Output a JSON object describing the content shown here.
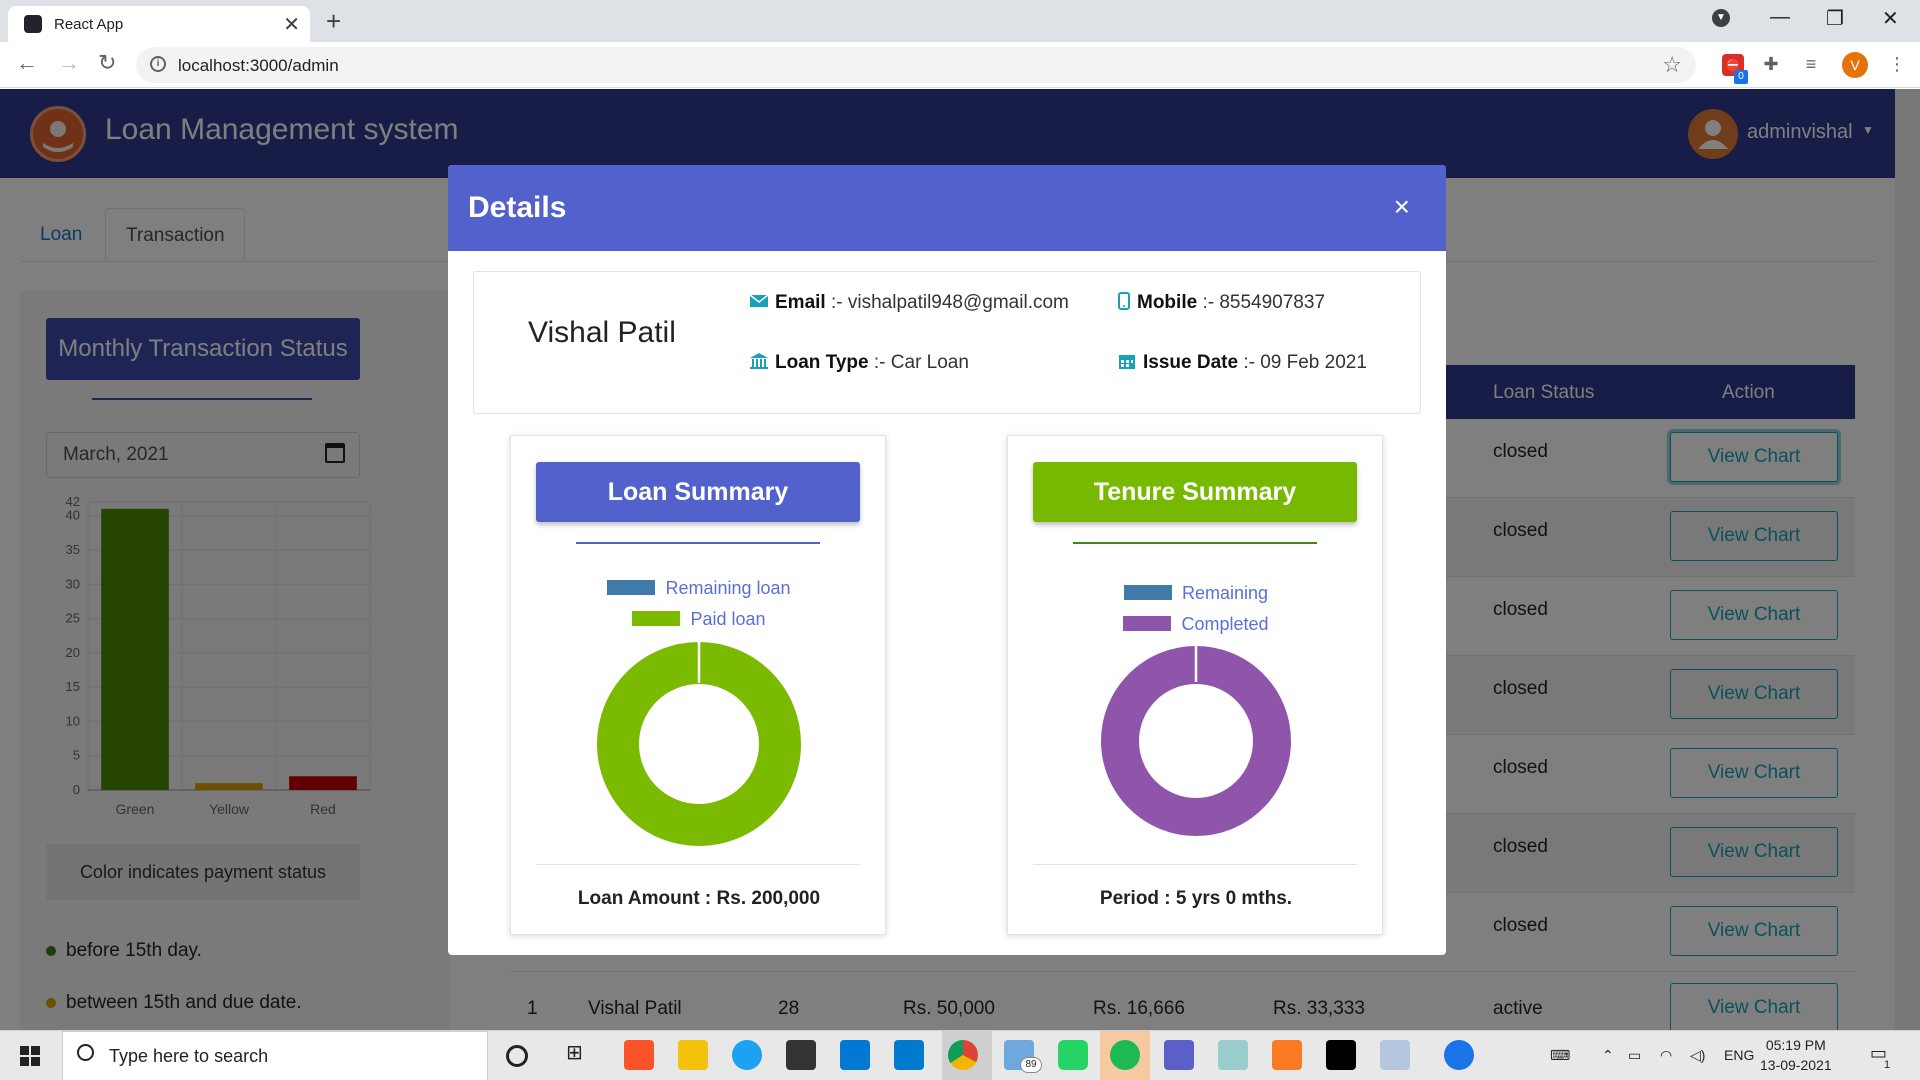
{
  "browser": {
    "tab_title": "React App",
    "url": "localhost:3000/admin",
    "profile_initial": "V",
    "extension_badge": "0"
  },
  "app": {
    "title": "Loan Management system",
    "user": "adminvishal",
    "tabs": [
      "Loan",
      "Transaction"
    ]
  },
  "sidebar": {
    "button_label": "Monthly Transaction Status",
    "month_value": "March, 2021",
    "chart_note": "Color indicates payment status",
    "legend": [
      {
        "label": "before 15th day.",
        "color": "#3a7d0a"
      },
      {
        "label": "between 15th and due date.",
        "color": "#d4a000"
      }
    ]
  },
  "chart_data": {
    "type": "bar",
    "categories": [
      "Green",
      "Yellow",
      "Red"
    ],
    "values": [
      41,
      1,
      2
    ],
    "colors": [
      "#4a8a00",
      "#d4a000",
      "#c00000"
    ],
    "yticks": [
      0,
      5,
      10,
      15,
      20,
      25,
      30,
      35,
      40,
      42
    ],
    "ylim": [
      0,
      42
    ]
  },
  "table": {
    "headers": [
      "Loan Status",
      "Action"
    ],
    "rows": [
      {
        "status": "closed",
        "action": "View Chart"
      },
      {
        "status": "closed",
        "action": "View Chart"
      },
      {
        "status": "closed",
        "action": "View Chart"
      },
      {
        "status": "closed",
        "action": "View Chart"
      },
      {
        "status": "closed",
        "action": "View Chart"
      },
      {
        "status": "closed",
        "action": "View Chart"
      },
      {
        "status": "closed",
        "action": "View Chart"
      }
    ],
    "last_row": {
      "id": "1",
      "name": "Vishal Patil",
      "tenure": "28",
      "amount": "Rs. 50,000",
      "paid": "Rs. 16,666",
      "remaining": "Rs. 33,333",
      "status": "active",
      "action": "View Chart"
    }
  },
  "modal": {
    "title": "Details",
    "close": "×",
    "name": "Vishal Patil",
    "email_label": "Email",
    "email_value": ":- vishalpatil948@gmail.com",
    "mobile_label": "Mobile",
    "mobile_value": ":- 8554907837",
    "loan_type_label": "Loan Type",
    "loan_type_value": ":- Car Loan",
    "issue_label": "Issue Date",
    "issue_value": ":- 09 Feb 2021",
    "loan_summary": {
      "title": "Loan Summary",
      "legend": [
        {
          "label": "Remaining loan",
          "color": "#3f7aa8"
        },
        {
          "label": "Paid loan",
          "color": "#7aba00"
        }
      ],
      "values": [
        0,
        100
      ],
      "footer": "Loan Amount : Rs. 200,000"
    },
    "tenure_summary": {
      "title": "Tenure Summary",
      "legend": [
        {
          "label": "Remaining",
          "color": "#3f7aa8"
        },
        {
          "label": "Completed",
          "color": "#8e55aa"
        }
      ],
      "values": [
        0,
        100
      ],
      "footer": "Period : 5 yrs 0 mths."
    }
  },
  "taskbar": {
    "search_placeholder": "Type here to search",
    "badge": "89",
    "lang": "ENG",
    "time": "05:19 PM",
    "date": "13-09-2021",
    "notif": "1"
  }
}
